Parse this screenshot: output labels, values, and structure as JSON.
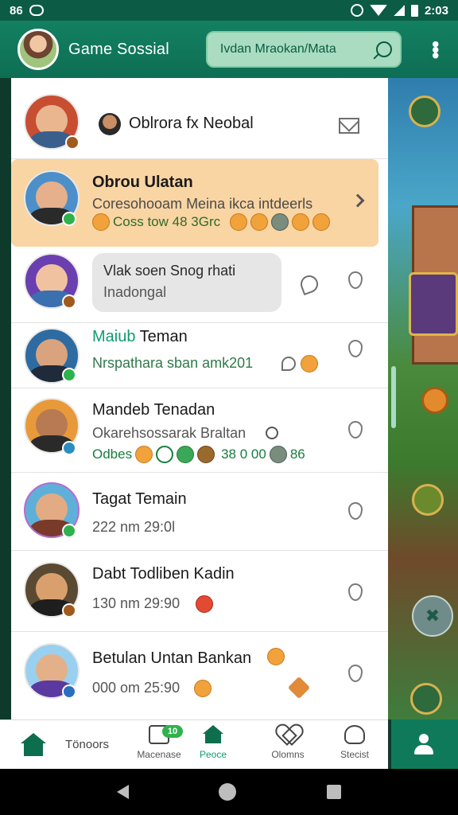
{
  "status_bar": {
    "left_text": "86",
    "time": "2:03"
  },
  "header": {
    "title": "Game Sossial",
    "search_text": "Ivdan Mraokan/Mata",
    "avatar_icon": "user-avatar"
  },
  "colors": {
    "primary": "#0e6e54",
    "accent": "#129a70",
    "highlight": "#f9d5a3",
    "badge_green": "#2fb24d"
  },
  "chats": [
    {
      "name": "Oblrora fx Neobal",
      "action_icon": "mail-icon"
    },
    {
      "name": "Obrou Ulatan",
      "message": "Coresohooam Meina ikca intdeerls",
      "reactions": "Coss tow 48 3Grc",
      "action_icon": "chevron-right-icon"
    },
    {
      "bubble_line1": "Vlak soen Snog rhati",
      "bubble_line2": "Inadongal",
      "action_icon": "pin-icon"
    },
    {
      "name_accent": "Maiub",
      "name_rest": " Teman",
      "message": "Nrspathara sban amk201",
      "action_icon": "pin-icon"
    },
    {
      "name": "Mandeb Tenadan",
      "message": "Okarehsossarak Braltan",
      "reactions": "Odbes",
      "reaction_value": "38 0 00",
      "reaction_tail": "86",
      "action_icon": "pin-icon"
    },
    {
      "name": "Tagat Temain",
      "message": "222 nm 29:0l",
      "action_icon": "pin-icon"
    },
    {
      "name": "Dabt Todliben Kadin",
      "message": "130 nm 29:90",
      "action_icon": "pin-icon"
    },
    {
      "name": "Betulan Untan Bankan",
      "message": "000 om 25:90",
      "action_icon": "pin-icon"
    }
  ],
  "bottom_nav": {
    "home_label": "Tönoors",
    "items": [
      {
        "label": "Macenase",
        "badge": "10"
      },
      {
        "label": "Peoce"
      },
      {
        "label": "Olomns"
      },
      {
        "label": "Stecist"
      }
    ]
  }
}
